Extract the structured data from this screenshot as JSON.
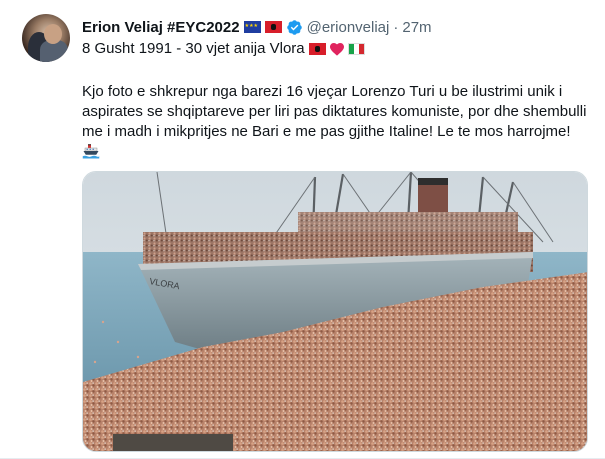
{
  "tweet": {
    "author_name": "Erion Veliaj #EYC2022",
    "handle": "@erionveliaj",
    "separator": "·",
    "time": "27m",
    "date_line": "8 Gusht 1991 - 30 vjet anija Vlora",
    "body": "Kjo foto e shkrepur nga barezi 16 vjeçar Lorenzo Turi u be ilustrimi unik i aspirates se shqiptareve per liri pas diktatures komuniste, por dhe shembulli me i madh i mikpritjes ne Bari e me pas gjithe Italine! Le te mos harrojme!",
    "ship_name": "VLORA",
    "icons": {
      "avatar": "avatar-photo",
      "flag_eu": "eu-flag-icon",
      "flag_al": "albania-flag-icon",
      "verified": "verified-badge-icon",
      "heart": "red-heart-icon",
      "flag_it": "italy-flag-icon",
      "ship": "ship-icon"
    },
    "colors": {
      "verified_blue": "#1d9bf0",
      "heart_red": "#e0245e",
      "secondary_text": "#536471"
    }
  }
}
